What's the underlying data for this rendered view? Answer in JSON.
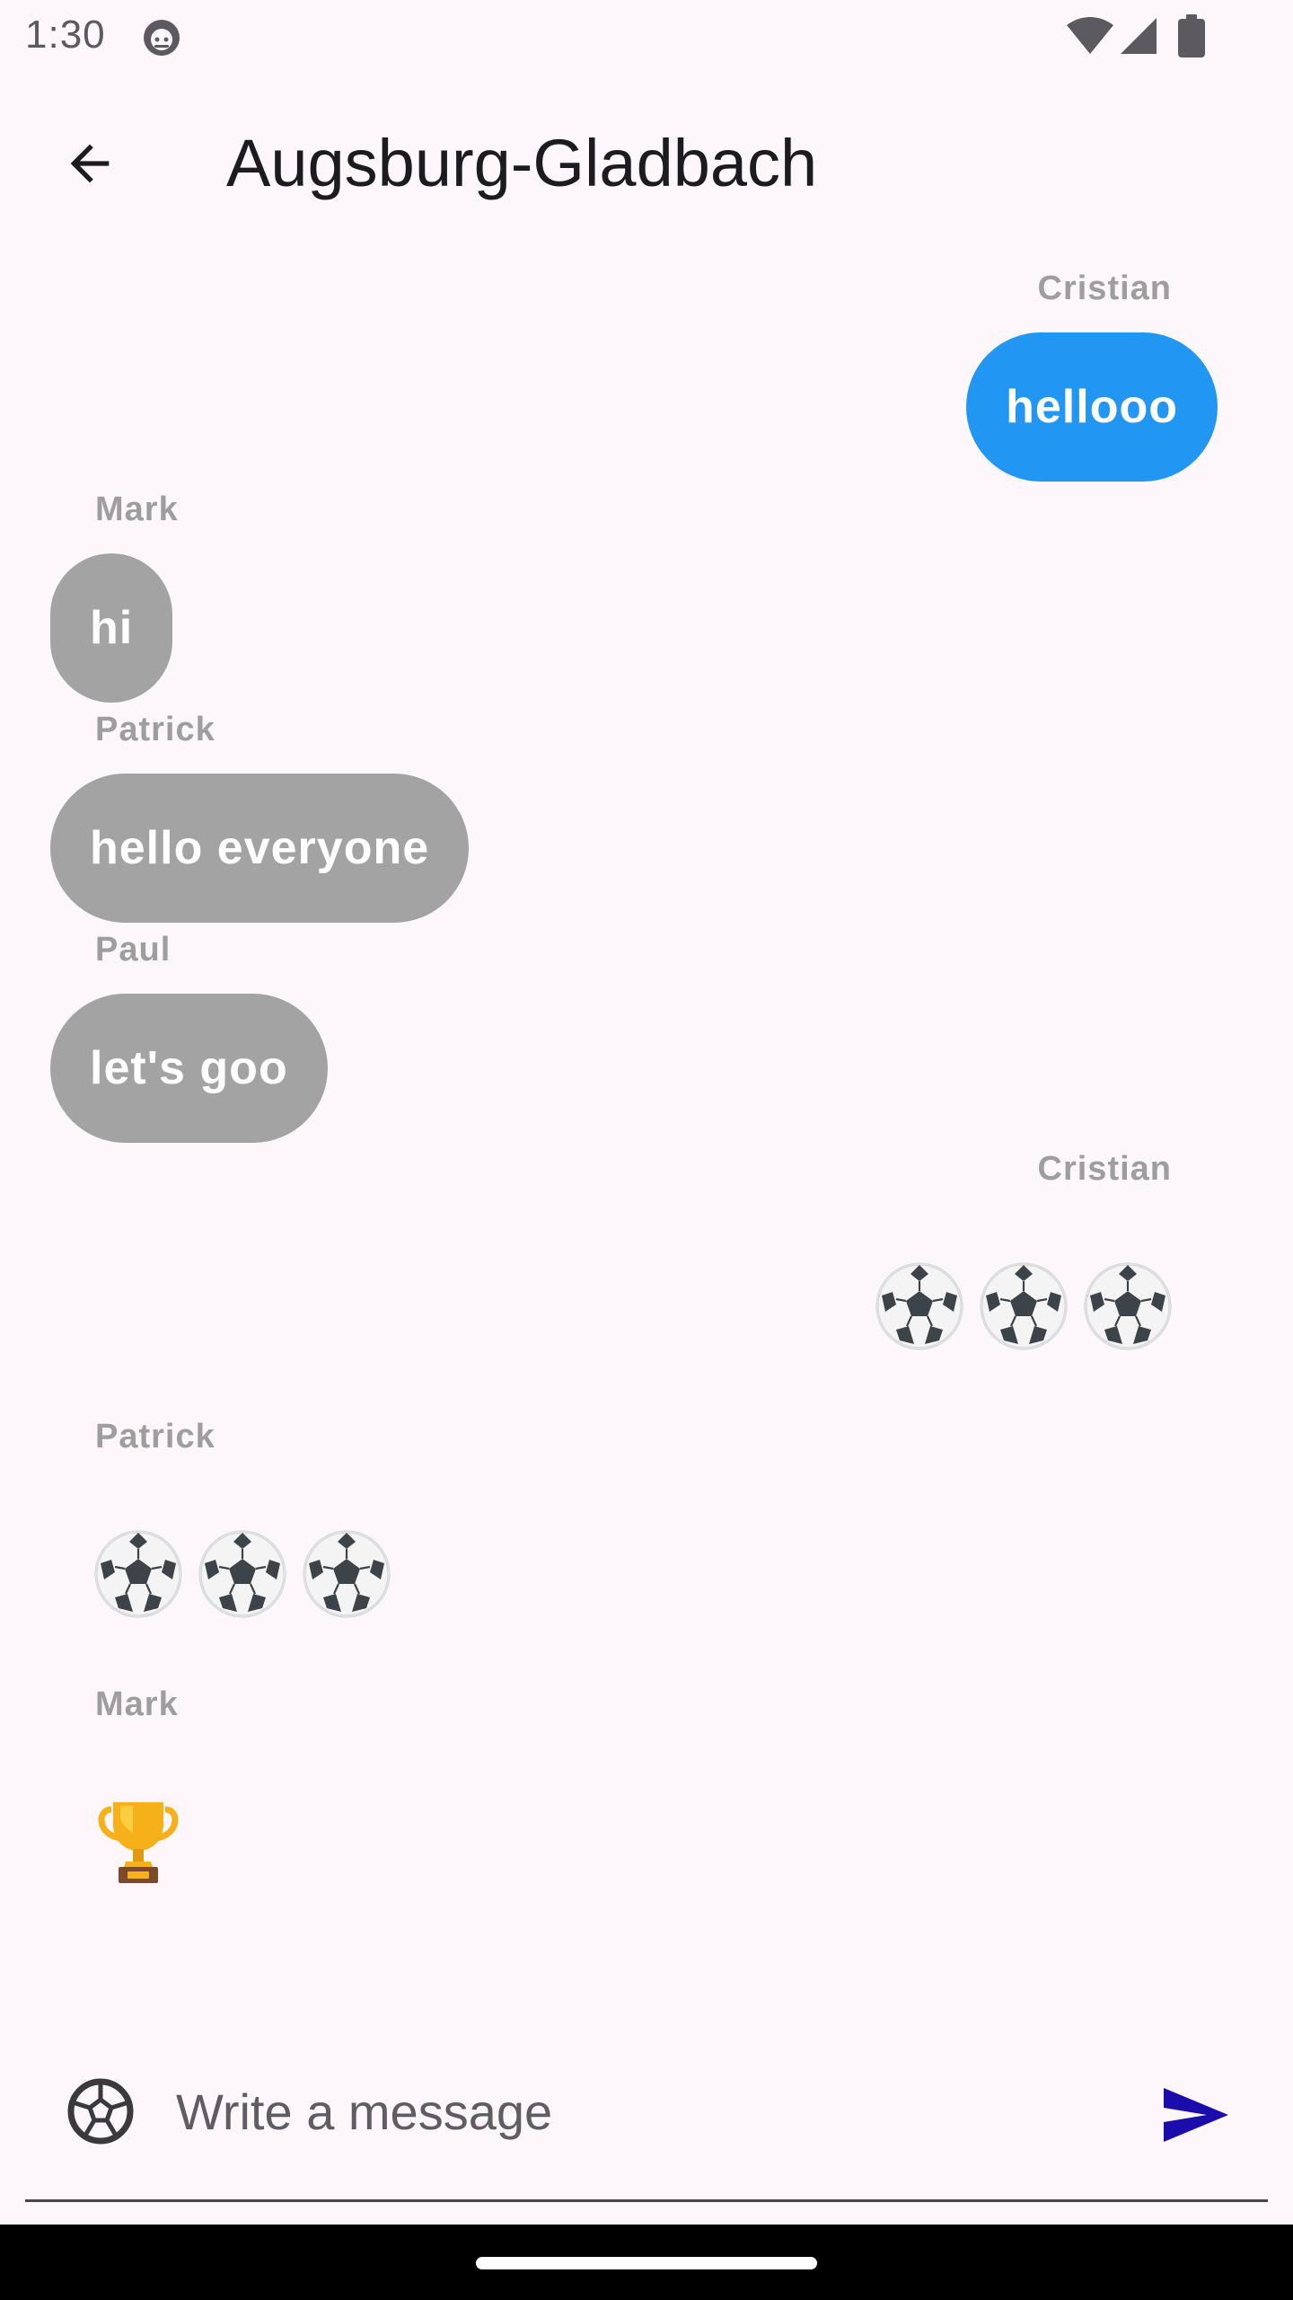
{
  "status_bar": {
    "time": "1:30",
    "icons": [
      "app-notification-icon",
      "wifi-icon",
      "cellular-signal-icon",
      "battery-icon"
    ]
  },
  "app_bar": {
    "back_icon": "arrow-back-icon",
    "title": "Augsburg-Gladbach"
  },
  "messages": [
    {
      "sender": "Cristian",
      "text": "hellooo",
      "side": "right",
      "kind": "bubble"
    },
    {
      "sender": "Mark",
      "text": "hi",
      "side": "left",
      "kind": "bubble"
    },
    {
      "sender": "Patrick",
      "text": "hello everyone",
      "side": "left",
      "kind": "bubble"
    },
    {
      "sender": "Paul",
      "text": "let's goo",
      "side": "left",
      "kind": "bubble"
    },
    {
      "sender": "Cristian",
      "text": "⚽⚽⚽",
      "side": "right",
      "kind": "emoji"
    },
    {
      "sender": "Patrick",
      "text": "⚽⚽⚽",
      "side": "left",
      "kind": "emoji"
    },
    {
      "sender": "Mark",
      "text": "🏆",
      "side": "left",
      "kind": "emoji"
    }
  ],
  "composer": {
    "placeholder": "Write a message",
    "value": "",
    "left_icon": "soccer-ball-icon",
    "send_icon": "send-icon"
  },
  "colors": {
    "background": "#fdf7fb",
    "my_bubble": "#2196f3",
    "other_bubble": "#a3a3a3",
    "sender_label": "#9e9e9e",
    "send_icon": "#1a0dab"
  }
}
